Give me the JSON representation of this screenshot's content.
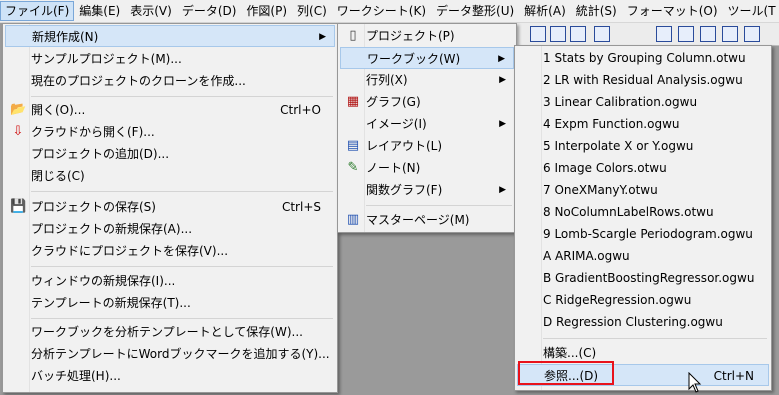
{
  "menubar": [
    {
      "label": "ファイル(F)",
      "active": true
    },
    {
      "label": "編集(E)"
    },
    {
      "label": "表示(V)"
    },
    {
      "label": "データ(D)"
    },
    {
      "label": "作図(P)"
    },
    {
      "label": "列(C)"
    },
    {
      "label": "ワークシート(K)"
    },
    {
      "label": "データ整形(U)"
    },
    {
      "label": "解析(A)"
    },
    {
      "label": "統計(S)"
    },
    {
      "label": "フォーマット(O)"
    },
    {
      "label": "ツール(T"
    }
  ],
  "file_menu": {
    "items": [
      {
        "label": "新規作成(N)",
        "submenu": true,
        "highlight": true
      },
      {
        "label": "サンプルプロジェクト(M)..."
      },
      {
        "label": "現在のプロジェクトのクローンを作成..."
      },
      {
        "label": "開く(O)...",
        "shortcut": "Ctrl+O",
        "icon": "open-folder-icon"
      },
      {
        "label": "クラウドから開く(F)...",
        "icon": "cloud-download-icon"
      },
      {
        "label": "プロジェクトの追加(D)..."
      },
      {
        "label": "閉じる(C)"
      },
      {
        "label": "プロジェクトの保存(S)",
        "shortcut": "Ctrl+S",
        "icon": "floppy-disk-icon"
      },
      {
        "label": "プロジェクトの新規保存(A)..."
      },
      {
        "label": "クラウドにプロジェクトを保存(V)..."
      },
      {
        "label": "ウィンドウの新規保存(I)..."
      },
      {
        "label": "テンプレートの新規保存(T)..."
      },
      {
        "label": "ワークブックを分析テンプレートとして保存(W)..."
      },
      {
        "label": "分析テンプレートにWordブックマークを追加する(Y)..."
      },
      {
        "label": "バッチ処理(H)..."
      }
    ]
  },
  "new_menu": {
    "items": [
      {
        "label": "プロジェクト(P)",
        "icon": "project-icon"
      },
      {
        "label": "ワークブック(W)",
        "submenu": true,
        "highlight": true
      },
      {
        "label": "行列(X)",
        "submenu": true
      },
      {
        "label": "グラフ(G)",
        "icon": "graph-icon"
      },
      {
        "label": "イメージ(I)",
        "submenu": true
      },
      {
        "label": "レイアウト(L)",
        "icon": "layout-icon"
      },
      {
        "label": "ノート(N)",
        "icon": "notes-icon"
      },
      {
        "label": "関数グラフ(F)",
        "submenu": true
      },
      {
        "label": "マスターページ(M)",
        "icon": "master-page-icon"
      }
    ]
  },
  "workbook_menu": {
    "items": [
      {
        "label": "1 Stats by Grouping Column.otwu"
      },
      {
        "label": "2 LR with Residual Analysis.ogwu"
      },
      {
        "label": "3 Linear Calibration.ogwu"
      },
      {
        "label": "4 Expm Function.ogwu"
      },
      {
        "label": "5 Interpolate X or Y.ogwu"
      },
      {
        "label": "6 Image Colors.otwu"
      },
      {
        "label": "7 OneXManyY.otwu"
      },
      {
        "label": "8 NoColumnLabelRows.otwu"
      },
      {
        "label": "9 Lomb-Scargle Periodogram.ogwu"
      },
      {
        "label": "A ARIMA.ogwu"
      },
      {
        "label": "B GradientBoostingRegressor.ogwu"
      },
      {
        "label": "C RidgeRegression.ogwu"
      },
      {
        "label": "D Regression Clustering.ogwu"
      },
      {
        "label": "構築...(C)"
      },
      {
        "label": "参照...(D)",
        "shortcut": "Ctrl+N",
        "highlight": true
      }
    ]
  },
  "colors": {
    "accent_box": "#e8121b",
    "highlight": "#d5e6f8"
  }
}
